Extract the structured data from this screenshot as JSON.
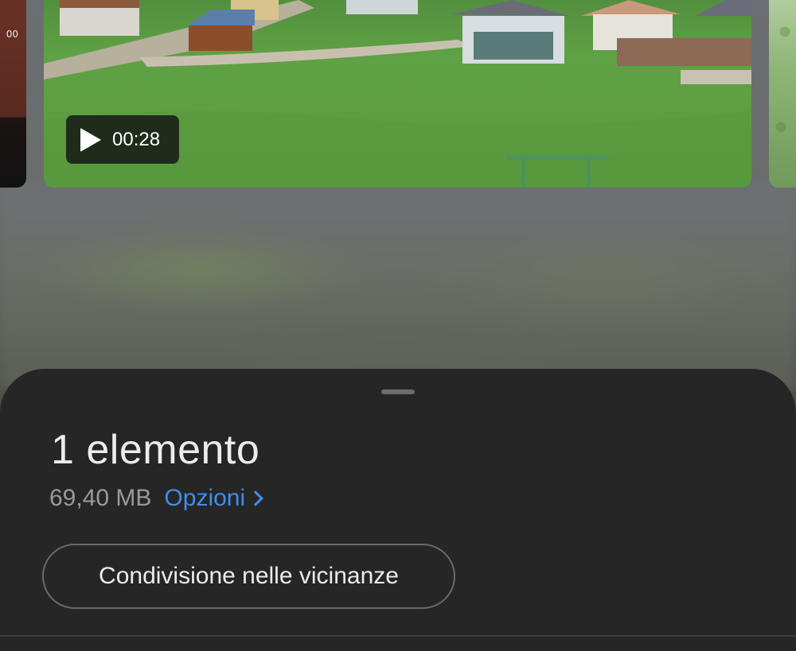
{
  "thumbnails": {
    "left_badge": "00",
    "main": {
      "duration": "00:28"
    }
  },
  "sheet": {
    "title": "1 elemento",
    "size": "69,40 MB",
    "options_label": "Opzioni",
    "nearby_share_label": "Condivisione nelle vicinanze"
  },
  "colors": {
    "sheet_bg": "#262626",
    "accent": "#3e8fe9"
  }
}
